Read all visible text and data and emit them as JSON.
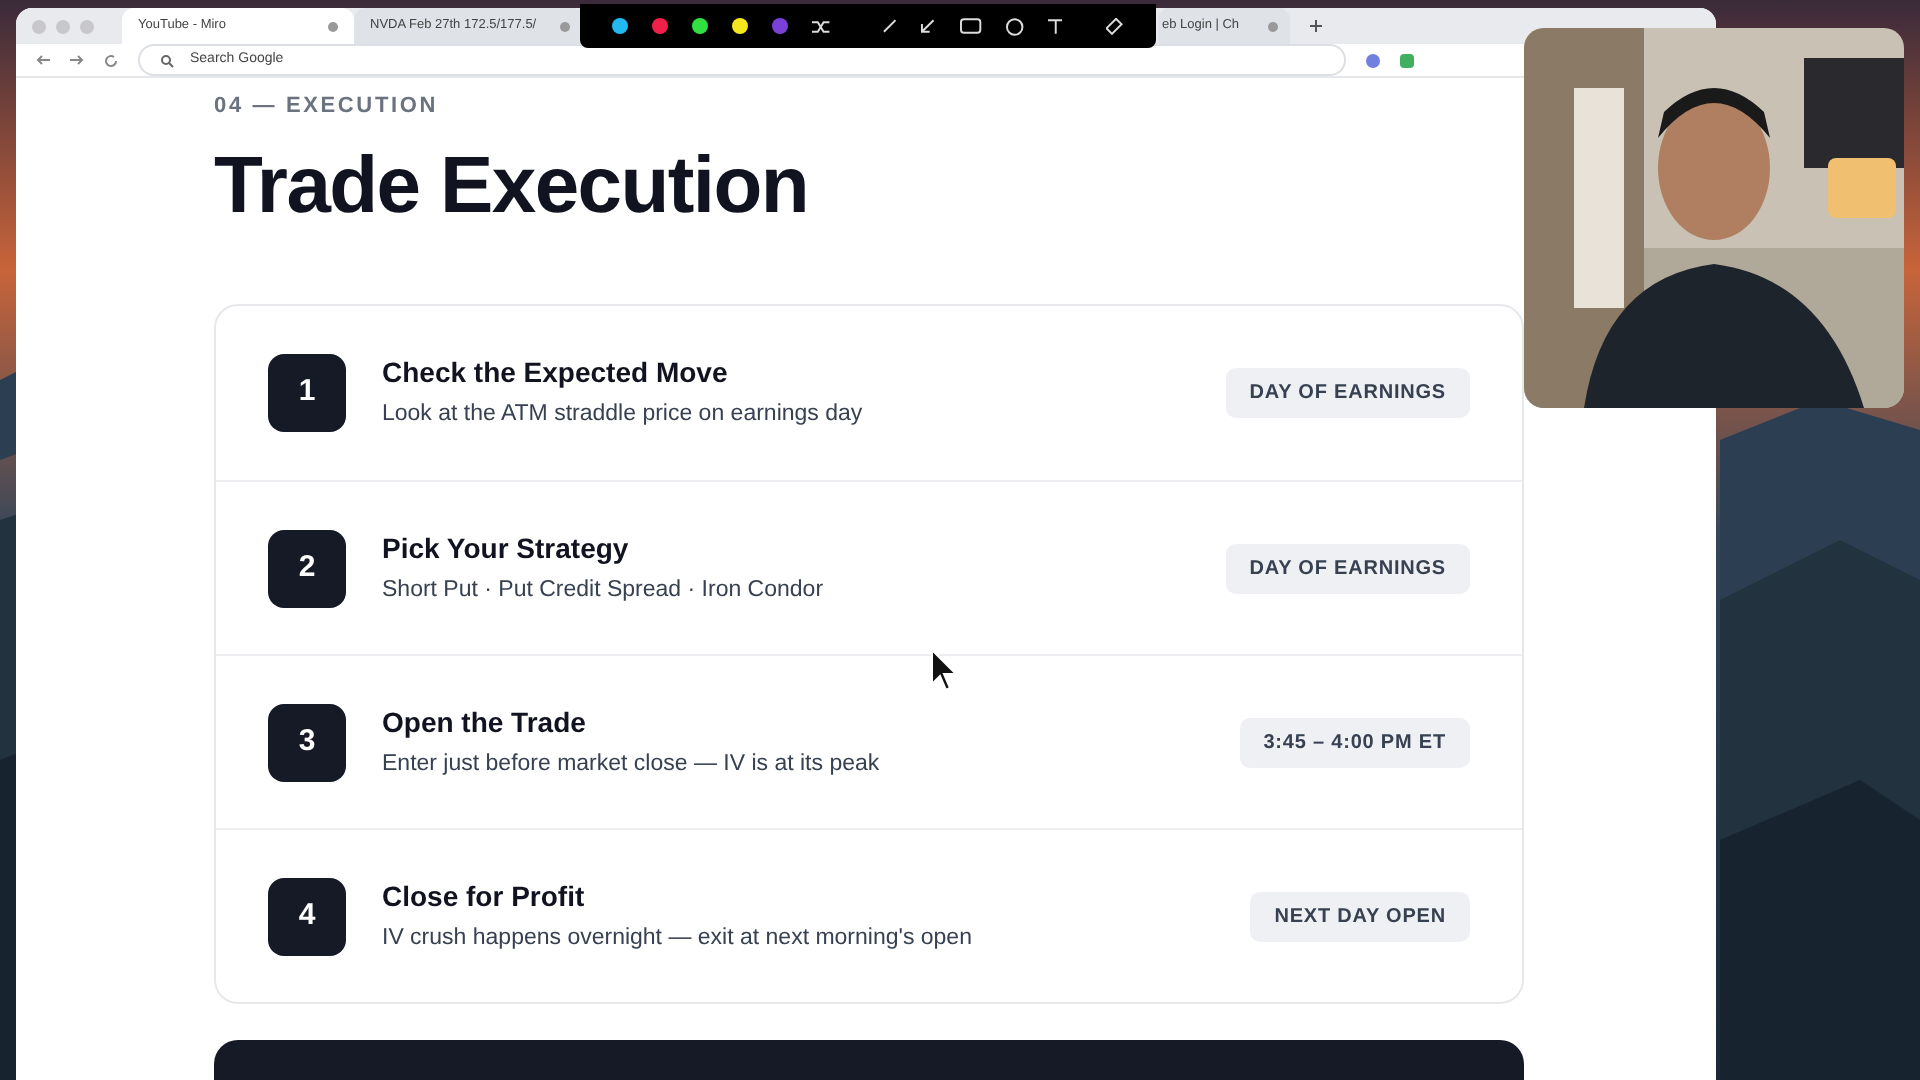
{
  "browser": {
    "tabs": [
      {
        "title": "YouTube - Miro",
        "selected": true
      },
      {
        "title": "NVDA Feb 27th 172.5/177.5/",
        "selected": false
      },
      {
        "title": "eb Login | Ch",
        "selected": false
      }
    ],
    "address": {
      "placeholder": "Search Google"
    }
  },
  "annotation_toolbar": {
    "colors": [
      {
        "color": "#22b8f0"
      },
      {
        "color": "#f0204a"
      },
      {
        "color": "#30e040"
      },
      {
        "color": "#f5e620"
      },
      {
        "color": "#7a40d8"
      }
    ]
  },
  "page": {
    "eyebrow": "04 — EXECUTION",
    "title": "Trade Execution",
    "steps": [
      {
        "number": "1",
        "title": "Check the Expected Move",
        "subtitle": "Look at the ATM straddle price on earnings day",
        "badge": "DAY OF EARNINGS"
      },
      {
        "number": "2",
        "title": "Pick Your Strategy",
        "subtitle": "Short Put · Put Credit Spread · Iron Condor",
        "badge": "DAY OF EARNINGS"
      },
      {
        "number": "3",
        "title": "Open the Trade",
        "subtitle": "Enter just before market close — IV is at its peak",
        "badge": "3:45 – 4:00 PM ET"
      },
      {
        "number": "4",
        "title": "Close for Profit",
        "subtitle": "IV crush happens overnight — exit at next morning's open",
        "badge": "NEXT DAY OPEN"
      }
    ]
  }
}
